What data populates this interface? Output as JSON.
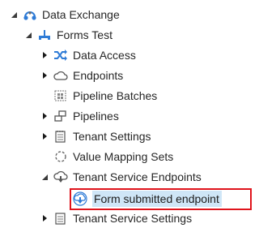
{
  "tree": {
    "root": {
      "label": "Data Exchange",
      "icon": "data-exchange-icon"
    },
    "child": {
      "label": "Forms Test",
      "icon": "forms-tree-icon"
    },
    "items": [
      {
        "label": "Data Access",
        "icon": "shuffle-icon",
        "expander": "collapsed"
      },
      {
        "label": "Endpoints",
        "icon": "cloud-icon",
        "expander": "collapsed"
      },
      {
        "label": "Pipeline Batches",
        "icon": "batch-grid-icon",
        "expander": "none"
      },
      {
        "label": "Pipelines",
        "icon": "pipeline-icon",
        "expander": "collapsed"
      },
      {
        "label": "Tenant Settings",
        "icon": "notepad-icon",
        "expander": "collapsed"
      },
      {
        "label": "Value Mapping Sets",
        "icon": "circle-dashed-icon",
        "expander": "none"
      },
      {
        "label": "Tenant Service Endpoints",
        "icon": "cloud-download-icon",
        "expander": "expanded"
      },
      {
        "label": "Tenant Service Settings",
        "icon": "notepad-icon",
        "expander": "collapsed"
      }
    ],
    "selected": {
      "label": "Form submitted endpoint",
      "icon": "cloud-download-icon"
    }
  },
  "colors": {
    "highlight_border": "#e0141c",
    "selection_bg": "#cfe6f7",
    "icon_blue": "#2e7bd6"
  }
}
